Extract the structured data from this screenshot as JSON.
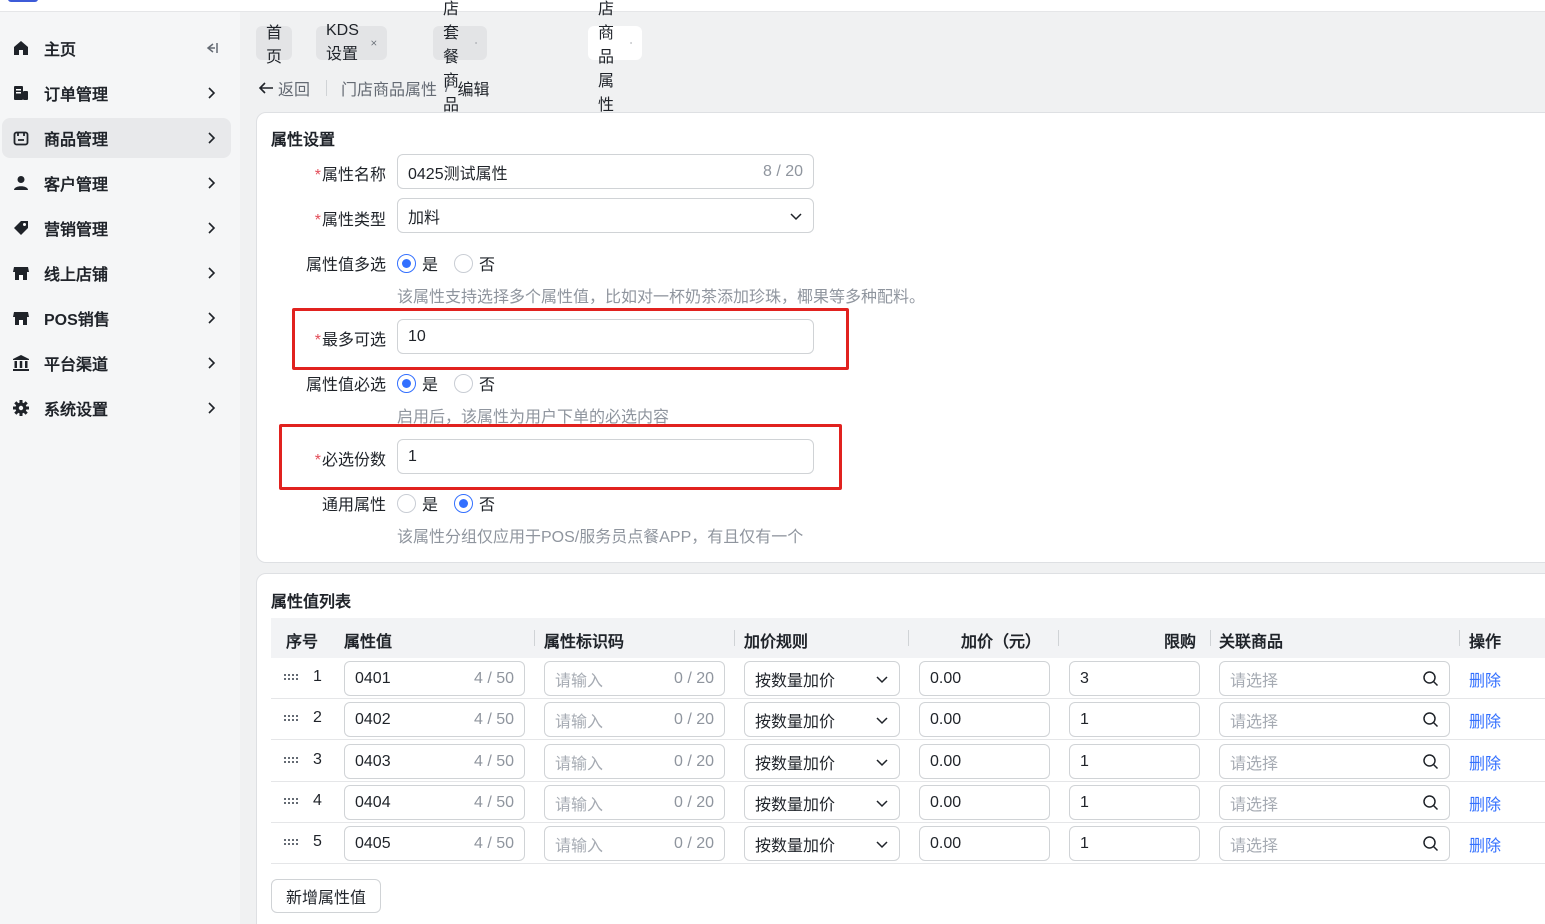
{
  "sidebar": {
    "items": [
      {
        "label": "主页",
        "icon": "home-icon"
      },
      {
        "label": "订单管理",
        "icon": "order-icon"
      },
      {
        "label": "商品管理",
        "icon": "product-icon"
      },
      {
        "label": "客户管理",
        "icon": "user-icon"
      },
      {
        "label": "营销管理",
        "icon": "tag-icon"
      },
      {
        "label": "线上店铺",
        "icon": "store-icon"
      },
      {
        "label": "POS销售",
        "icon": "pos-store-icon"
      },
      {
        "label": "平台渠道",
        "icon": "bank-icon"
      },
      {
        "label": "系统设置",
        "icon": "gear-icon"
      }
    ]
  },
  "tabs": [
    {
      "label": "首页",
      "closable": false
    },
    {
      "label": "KDS设置",
      "closable": true
    },
    {
      "label": "门店套餐商品",
      "closable": true
    },
    {
      "label": "门店商品属性",
      "closable": true,
      "active": true
    }
  ],
  "breadcrumb": {
    "back": "返回",
    "parent": "门店商品属性",
    "sep": "/",
    "current": "编辑"
  },
  "settings": {
    "title": "属性设置",
    "name_label": "属性名称",
    "name_value": "0425测试属性",
    "name_counter": "8 / 20",
    "type_label": "属性类型",
    "type_value": "加料",
    "multi_label": "属性值多选",
    "multi_yes": "是",
    "multi_no": "否",
    "multi_hint": "该属性支持选择多个属性值，比如对一杯奶茶添加珍珠，椰果等多种配料。",
    "max_label": "最多可选",
    "max_value": "10",
    "required_label": "属性值必选",
    "required_yes": "是",
    "required_no": "否",
    "required_hint": "启用后，该属性为用户下单的必选内容",
    "count_label": "必选份数",
    "count_value": "1",
    "common_label": "通用属性",
    "common_yes": "是",
    "common_no": "否",
    "common_hint": "该属性分组仅应用于POS/服务员点餐APP，有且仅有一个"
  },
  "table": {
    "title": "属性值列表",
    "headers": {
      "index": "序号",
      "value": "属性值",
      "code": "属性标识码",
      "rule": "加价规则",
      "price": "加价（元）",
      "limit": "限购",
      "linked": "关联商品",
      "ops": "操作"
    },
    "placeholders": {
      "code": "请输入",
      "linked": "请选择"
    },
    "rows": [
      {
        "index": "1",
        "value": "0401",
        "value_counter": "4 / 50",
        "code_counter": "0 / 20",
        "rule": "按数量加价",
        "price": "0.00",
        "limit": "3",
        "op": "删除"
      },
      {
        "index": "2",
        "value": "0402",
        "value_counter": "4 / 50",
        "code_counter": "0 / 20",
        "rule": "按数量加价",
        "price": "0.00",
        "limit": "1",
        "op": "删除"
      },
      {
        "index": "3",
        "value": "0403",
        "value_counter": "4 / 50",
        "code_counter": "0 / 20",
        "rule": "按数量加价",
        "price": "0.00",
        "limit": "1",
        "op": "删除"
      },
      {
        "index": "4",
        "value": "0404",
        "value_counter": "4 / 50",
        "code_counter": "0 / 20",
        "rule": "按数量加价",
        "price": "0.00",
        "limit": "1",
        "op": "删除"
      },
      {
        "index": "5",
        "value": "0405",
        "value_counter": "4 / 50",
        "code_counter": "0 / 20",
        "rule": "按数量加价",
        "price": "0.00",
        "limit": "1",
        "op": "删除"
      }
    ],
    "add_button": "新增属性值"
  },
  "colors": {
    "accent": "#3370ff",
    "highlight": "#e1221f",
    "required": "#e34d59"
  }
}
